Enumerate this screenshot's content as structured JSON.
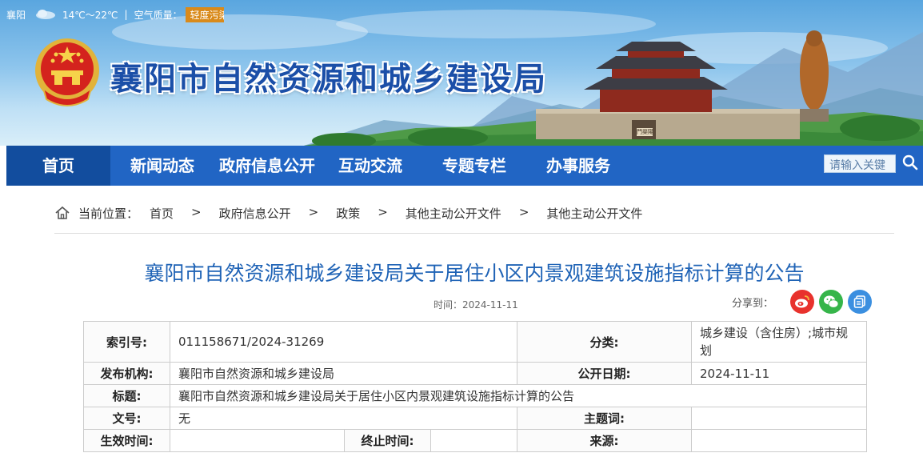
{
  "topbar": {
    "city": "襄阳",
    "temperature": "14℃～22℃",
    "air_quality_label": "空气质量：",
    "air_quality_value": "轻度污染"
  },
  "header": {
    "site_title": "襄阳市自然资源和城乡建设局",
    "gate_sign": "門渠陽"
  },
  "nav": {
    "items": [
      {
        "label": "首页",
        "active": true
      },
      {
        "label": "新闻动态"
      },
      {
        "label": "政府信息公开"
      },
      {
        "label": "互动交流"
      },
      {
        "label": "专题专栏"
      },
      {
        "label": "办事服务"
      }
    ],
    "search_placeholder": "请输入关键"
  },
  "breadcrumb": {
    "label": "当前位置：",
    "items": [
      "首页",
      "政府信息公开",
      "政策",
      "其他主动公开文件",
      "其他主动公开文件"
    ],
    "separator": ">"
  },
  "article": {
    "title": "襄阳市自然资源和城乡建设局关于居住小区内景观建筑设施指标计算的公告",
    "time_label": "时间：2024-11-11",
    "share_label": "分享到："
  },
  "info_table": {
    "index_key": "索引号:",
    "index_value": "011158671/2024-31269",
    "category_key": "分类:",
    "category_value": "城乡建设（含住房）;城市规划",
    "issuer_key": "发布机构:",
    "issuer_value": "襄阳市自然资源和城乡建设局",
    "date_key": "公开日期:",
    "date_value": "2024-11-11",
    "title_key": "标题:",
    "title_value": "襄阳市自然资源和城乡建设局关于居住小区内景观建筑设施指标计算的公告",
    "docno_key": "文号:",
    "docno_value": "无",
    "keywords_key": "主题词:",
    "keywords_value": "",
    "effective_key": "生效时间:",
    "effective_value": "",
    "end_key": "终止时间:",
    "end_value": "",
    "source_key": "来源:",
    "source_value": ""
  },
  "colors": {
    "nav_bg": "#2165c4",
    "nav_active": "#124d9e",
    "title_blue": "#1f63b6",
    "aq_badge": "#d98a1a"
  }
}
